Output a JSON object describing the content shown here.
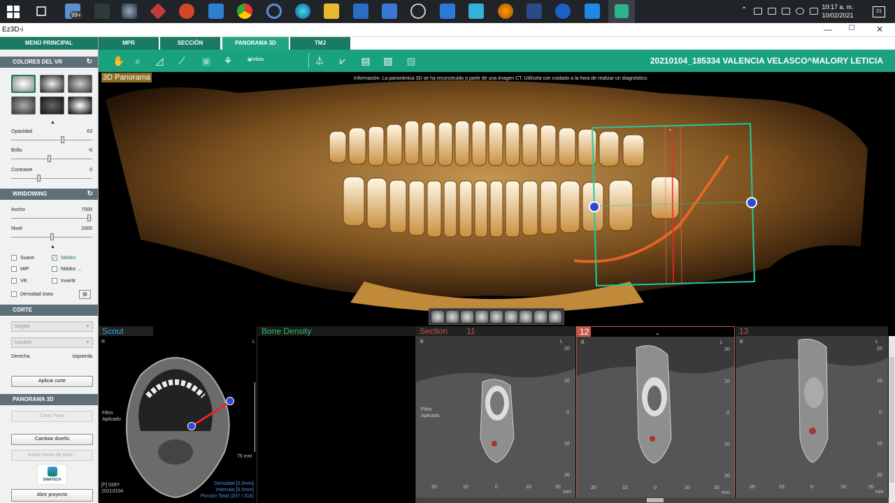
{
  "taskbar": {
    "badge": "99+",
    "time": "10:17 a. m.",
    "date": "10/02/2021",
    "notifications": "21"
  },
  "window": {
    "title": "Ez3D-i",
    "minimize": "—",
    "maximize": "☐",
    "close": "✕"
  },
  "sidebar": {
    "menu_principal": "MENÚ PRINCIPAL",
    "colores_vr": "COLORES DEL VR",
    "opacidad_label": "Opacidad",
    "opacidad_value": "63",
    "brillo_label": "Brillo",
    "brillo_value": "-6",
    "contraste_label": "Contraste",
    "contraste_value": "0",
    "windowing": "WINDOWING",
    "ancho_label": "Ancho",
    "ancho_value": "7000",
    "nivel_label": "Nivel",
    "nivel_value": "2000",
    "suave": "Suave",
    "nitidez": "Nitidez",
    "mip": "MIP",
    "nitidez2": "Nitidez ...",
    "vr": "VR",
    "invertir": "Invertir",
    "densidad": "Densidad ósea",
    "corte": "CORTE",
    "sagital": "Sagital",
    "usuario": "Usuario",
    "derecha": "Derecha",
    "izquierda": "Izquierda",
    "aplicar_corte": "Aplicar corte",
    "panorama3d": "PANORAMA 3D",
    "crear_pano": "Crear Pano",
    "cambiar_diseno": "Cambiar diseño",
    "iniciar_modo": "Iniciar modo de pant...",
    "logo_text": "DIMATECH",
    "abrir_proyecto": "Abrir proyecto"
  },
  "tabs": [
    "MPR",
    "SECCIÓN",
    "PANORAMA 3D",
    "TMJ"
  ],
  "toolbar": {
    "medida": "Medida",
    "patient": "20210104_185334 VALENCIA VELASCO^MALORY LETICIA"
  },
  "viewer3d": {
    "label": "3D Panorama",
    "info": "Información: La panorámica 3D se ha reconstruido a partir de una imagen CT. Utilícela con cuidado a la hora de realizar un diagnóstico."
  },
  "scout": {
    "label": "Scout",
    "r": "R",
    "l": "L",
    "filtro": "Filtro",
    "aplicado": "Aplicado",
    "mm": "75 mm",
    "f_label": "[F] 028Y",
    "date": "20210104",
    "densidad": "Densidad [0.0mm]",
    "intervalo": "Intervalo [0.5mm]",
    "porcion": "Porción Total (207 / 316)"
  },
  "bone_density": {
    "label": "Bone Density"
  },
  "sections": {
    "label": "Section",
    "numbers": [
      "11",
      "12",
      "13"
    ],
    "b": "B",
    "l": "L",
    "filtro": "Filtro",
    "aplicado": "Aplicado",
    "ticks_y": [
      "20",
      "10",
      "0",
      "10",
      "20"
    ],
    "ticks_x": [
      "20",
      "10",
      "0",
      "10",
      "20"
    ],
    "mm": "mm"
  },
  "colors": {
    "brand": "#1a7a64",
    "toolbar": "#1aa27f",
    "section_label": "#c8584a",
    "scout_label": "#3aa0e6",
    "bone_label": "#2fbf6a"
  }
}
